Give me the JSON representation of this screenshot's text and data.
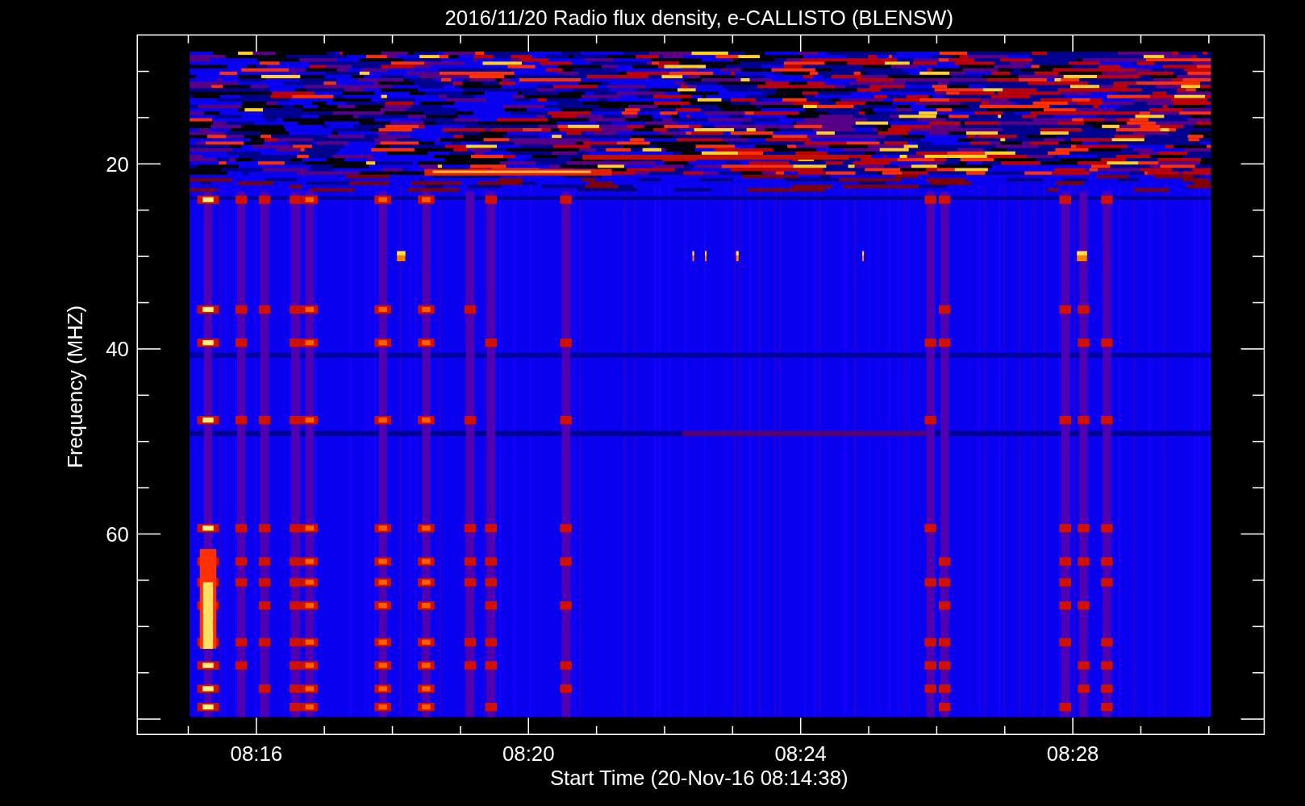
{
  "title": "2016/11/20  Radio flux density, e-CALLISTO (BLENSW)",
  "y_axis": {
    "label": "Frequency (MHZ)",
    "ticks": [
      "20",
      "40",
      "60"
    ]
  },
  "x_axis": {
    "label": "Start Time (20-Nov-16 08:14:38)",
    "ticks": [
      "08:16",
      "08:20",
      "08:24",
      "08:28"
    ]
  }
}
